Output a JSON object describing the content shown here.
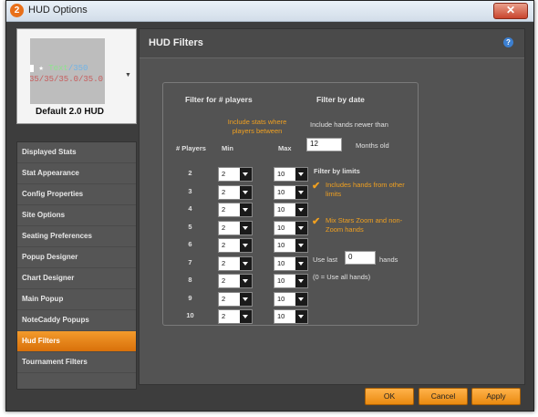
{
  "window": {
    "title": "HUD Options",
    "icon_glyph": "2"
  },
  "preview": {
    "line1_star": "★",
    "line1_text": "Text",
    "line1_num": "/350",
    "line2": "35/35/35.0/35.0",
    "label": "Default 2.0 HUD"
  },
  "sidebar": {
    "items": [
      {
        "label": "Displayed Stats"
      },
      {
        "label": "Stat Appearance"
      },
      {
        "label": "Config Properties"
      },
      {
        "label": "Site Options"
      },
      {
        "label": "Seating Preferences"
      },
      {
        "label": "Popup Designer"
      },
      {
        "label": "Chart Designer"
      },
      {
        "label": "Main Popup"
      },
      {
        "label": "NoteCaddy Popups"
      },
      {
        "label": "Hud Filters",
        "active": true
      },
      {
        "label": "Tournament Filters"
      }
    ]
  },
  "main": {
    "title": "HUD Filters",
    "help_icon": "?",
    "players": {
      "header": "Filter for # players",
      "note": "Include stats where players between",
      "col_players": "# Players",
      "col_min": "Min",
      "col_max": "Max",
      "rows": [
        {
          "players": "2",
          "min": "2",
          "max": "10"
        },
        {
          "players": "3",
          "min": "2",
          "max": "10"
        },
        {
          "players": "4",
          "min": "2",
          "max": "10"
        },
        {
          "players": "5",
          "min": "2",
          "max": "10"
        },
        {
          "players": "6",
          "min": "2",
          "max": "10"
        },
        {
          "players": "7",
          "min": "2",
          "max": "10"
        },
        {
          "players": "8",
          "min": "2",
          "max": "10"
        },
        {
          "players": "9",
          "min": "2",
          "max": "10"
        },
        {
          "players": "10",
          "min": "2",
          "max": "10"
        }
      ]
    },
    "date": {
      "header": "Filter by date",
      "note": "Include hands newer than",
      "value": "12",
      "unit": "Months old"
    },
    "limits": {
      "header": "Filter by limits",
      "opt1": "Includes hands from other limits",
      "opt1_checked": true,
      "opt2": "Mix Stars Zoom and non-Zoom hands",
      "opt2_checked": true,
      "use_last_label": "Use last",
      "use_last_value": "0",
      "hands_label": "hands",
      "hint": "(0 = Use all hands)"
    }
  },
  "buttons": {
    "ok": "OK",
    "cancel": "Cancel",
    "apply": "Apply"
  },
  "colors": {
    "accent": "#f39b2c",
    "panel": "#535353",
    "orange_text": "#f0a020"
  }
}
